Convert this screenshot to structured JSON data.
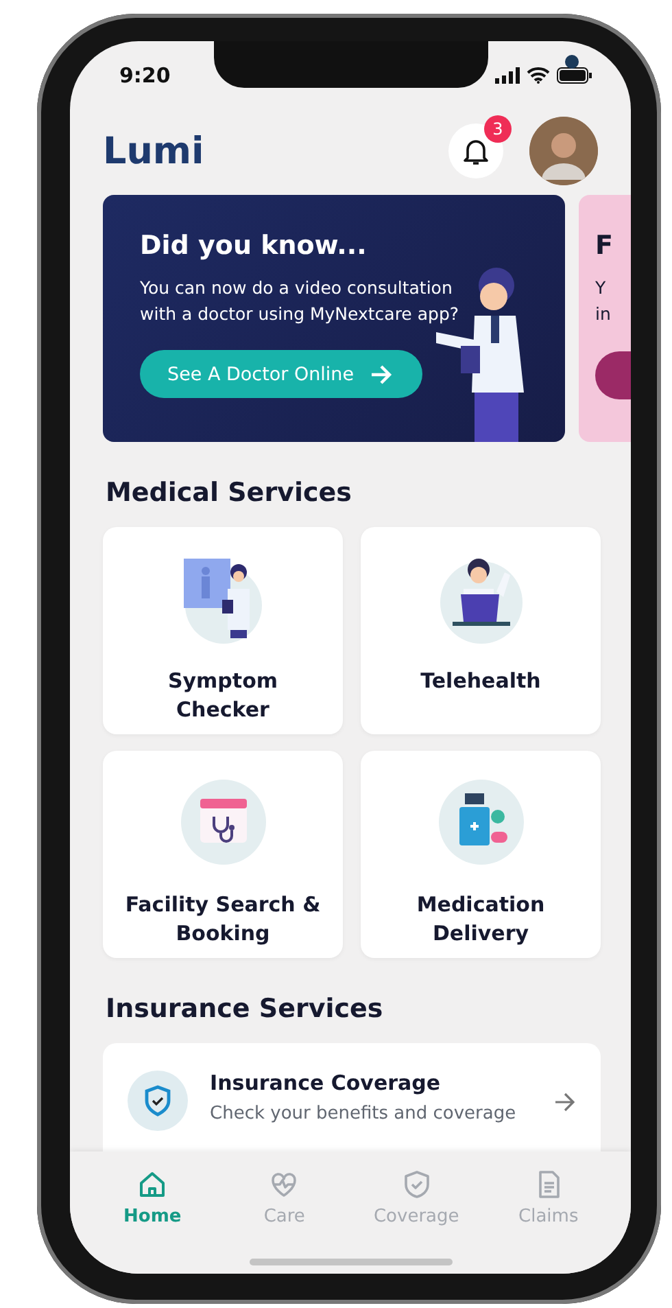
{
  "status_bar": {
    "time": "9:20"
  },
  "header": {
    "title": "Lumi",
    "notification_count": "3"
  },
  "banners": [
    {
      "title": "Did you know...",
      "text": "You can now do a video consultation with a doctor using MyNextcare app?",
      "button": "See A Doctor Online"
    },
    {
      "title": "F",
      "text": "Y in"
    }
  ],
  "medical_services": {
    "heading": "Medical Services",
    "items": [
      {
        "label": "Symptom Checker",
        "kind": "symptom"
      },
      {
        "label": "Telehealth",
        "kind": "telehealth"
      },
      {
        "label": "Facility Search & Booking",
        "kind": "facility"
      },
      {
        "label": "Medication Delivery",
        "kind": "medication"
      }
    ]
  },
  "insurance_services": {
    "heading": "Insurance Services",
    "items": [
      {
        "title": "Insurance Coverage",
        "subtitle": "Check your benefits and coverage"
      }
    ]
  },
  "tab_bar": [
    {
      "label": "Home",
      "kind": "home",
      "selected": true
    },
    {
      "label": "Care",
      "kind": "care",
      "selected": false
    },
    {
      "label": "Coverage",
      "kind": "coverage",
      "selected": false
    },
    {
      "label": "Claims",
      "kind": "claims",
      "selected": false
    }
  ]
}
